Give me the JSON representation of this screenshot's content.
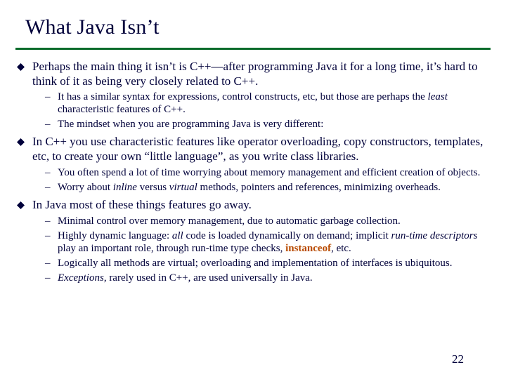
{
  "title": "What Java Isn’t",
  "bullets": {
    "b1": "Perhaps the main thing it isn’t is C++—after programming Java it for a long time, it’s hard to think of it as being very closely related to C++.",
    "b1s1_a": "It has a similar syntax for expressions, control constructs, etc, but those are perhaps the ",
    "b1s1_b": "least",
    "b1s1_c": " characteristic features of C++.",
    "b1s2": "The mindset when you are programming Java is very different:",
    "b2": "In C++ you use characteristic features like operator overloading, copy constructors, templates, etc, to create your own “little language”, as you write class libraries.",
    "b2s1": "You often spend a lot of time worrying about memory management and efficient creation of objects.",
    "b2s2_a": "Worry about ",
    "b2s2_b": "inline",
    "b2s2_c": " versus ",
    "b2s2_d": "virtual",
    "b2s2_e": " methods, pointers and references,  minimizing overheads.",
    "b3": "In Java most of these things features go away.",
    "b3s1": "Minimal control over memory management, due to automatic garbage collection.",
    "b3s2_a": "Highly dynamic language: ",
    "b3s2_b": "all",
    "b3s2_c": " code is loaded dynamically on demand; implicit ",
    "b3s2_d": "run-time descriptors",
    "b3s2_e": " play an important role, through run-time type checks, ",
    "b3s2_f": "instanceof",
    "b3s2_g": ", etc.",
    "b3s3": "Logically all methods are virtual; overloading and implementation of interfaces is ubiquitous.",
    "b3s4_a": "Exceptions",
    "b3s4_b": ", rarely used in C++, are used universally in Java."
  },
  "page_number": "22"
}
